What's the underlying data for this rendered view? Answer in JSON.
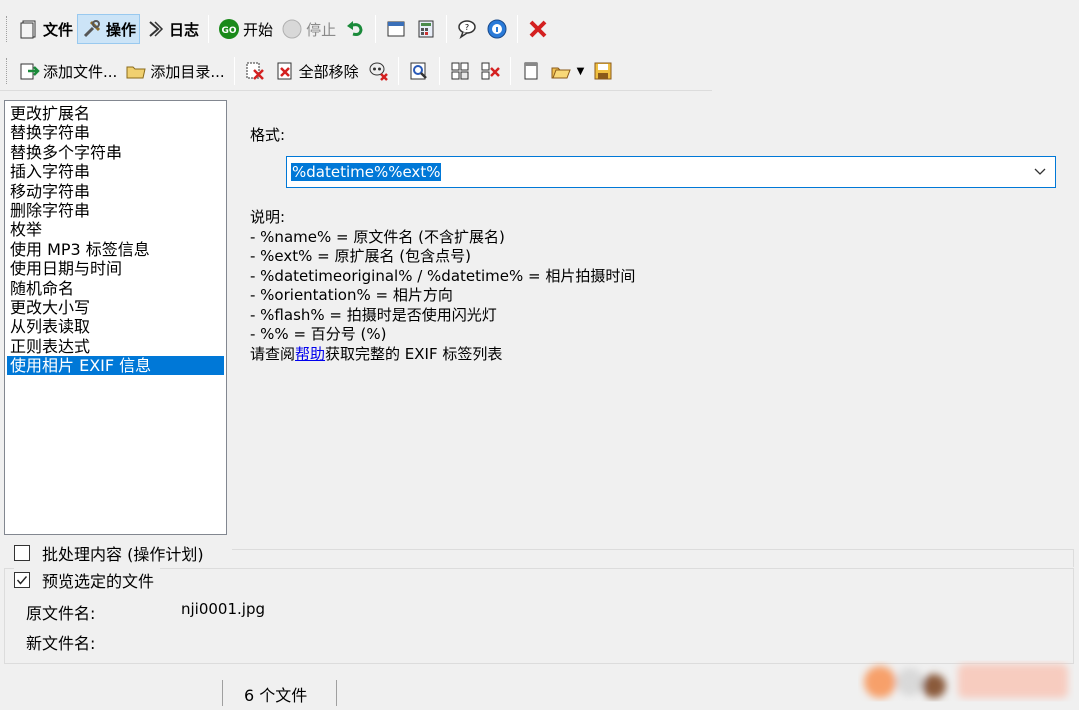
{
  "toolbar_main": {
    "file_label": "文件",
    "action_label": "操作",
    "log_label": "日志",
    "start_label": "开始",
    "stop_label": "停止"
  },
  "toolbar_files": {
    "add_files_label": "添加文件...",
    "add_dir_label": "添加目录...",
    "remove_all_label": "全部移除"
  },
  "operations": [
    "更改扩展名",
    "替换字符串",
    "替换多个字符串",
    "插入字符串",
    "移动字符串",
    "删除字符串",
    "枚举",
    "使用 MP3 标签信息",
    "使用日期与时间",
    "随机命名",
    "更改大小写",
    "从列表读取",
    "正则表达式",
    "使用相片 EXIF 信息"
  ],
  "format": {
    "label": "格式:",
    "value": "%datetime%%ext%"
  },
  "description": {
    "heading": "说明:",
    "lines": [
      "- %name% = 原文件名 (不含扩展名)",
      "- %ext% = 原扩展名 (包含点号)",
      "- %datetimeoriginal% / %datetime% = 相片拍摄时间",
      "- %orientation% = 相片方向",
      "- %flash% = 拍摄时是否使用闪光灯",
      "- %% = 百分号 (%)"
    ],
    "help_prefix": "请查阅",
    "help_link": "帮助",
    "help_suffix": "获取完整的 EXIF 标签列表"
  },
  "batch_checkbox_label": "批处理内容 (操作计划)",
  "preview_checkbox_label": "预览选定的文件",
  "preview": {
    "original_label": "原文件名:",
    "original_value": "nji0001.jpg",
    "new_label": "新文件名:"
  },
  "status": {
    "file_count": "6 个文件"
  },
  "colors": {
    "selection": "#0078d7",
    "start_green": "#1a8a1a",
    "close_red": "#d42020"
  }
}
